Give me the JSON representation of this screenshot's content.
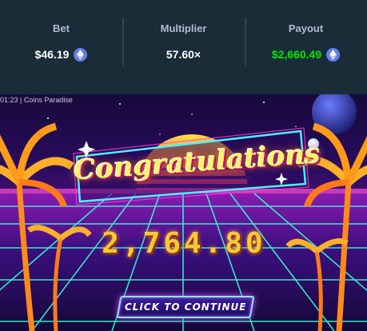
{
  "stats": {
    "bet": {
      "label": "Bet",
      "value": "$46.19",
      "currency_icon": "ethereum-icon"
    },
    "multiplier": {
      "label": "Multiplier",
      "value": "57.60×"
    },
    "payout": {
      "label": "Payout",
      "value": "$2,660.49",
      "currency_icon": "ethereum-icon",
      "color": "#00e701"
    }
  },
  "game": {
    "caption": "01:23 | Coins Paradise",
    "headline": "Congratulations",
    "win_amount": "2,764.80",
    "continue_label": "CLICK TO CONTINUE"
  },
  "colors": {
    "background": "#1a2c38",
    "label": "#b1bad3",
    "divider": "#2f4553",
    "eth": "#627eea",
    "payout": "#00e701"
  }
}
